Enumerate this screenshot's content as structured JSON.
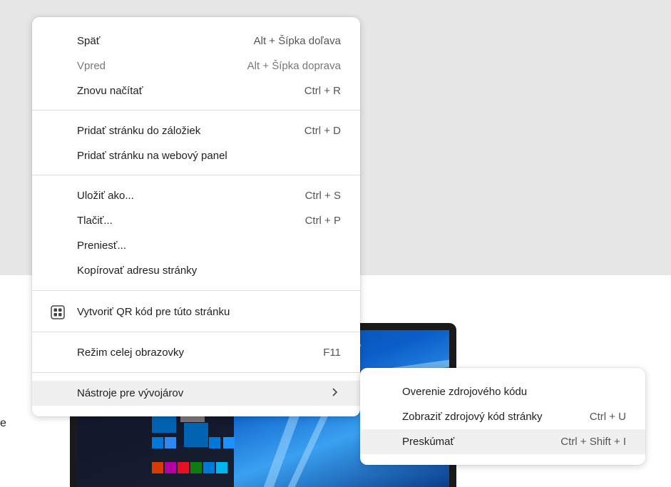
{
  "page": {
    "side_text": "e"
  },
  "context_menu": {
    "items": [
      {
        "label": "Späť",
        "shortcut": "Alt + Šípka doľava"
      },
      {
        "label": "Vpred",
        "shortcut": "Alt + Šípka doprava"
      },
      {
        "label": "Znovu načítať",
        "shortcut": "Ctrl + R"
      },
      {
        "label": "Pridať stránku do záložiek",
        "shortcut": "Ctrl + D"
      },
      {
        "label": "Pridať stránku na webový panel",
        "shortcut": ""
      },
      {
        "label": "Uložiť ako...",
        "shortcut": "Ctrl + S"
      },
      {
        "label": "Tlačiť...",
        "shortcut": "Ctrl + P"
      },
      {
        "label": "Preniesť...",
        "shortcut": ""
      },
      {
        "label": "Kopírovať adresu stránky",
        "shortcut": ""
      },
      {
        "label": "Vytvoriť QR kód pre túto stránku",
        "shortcut": "",
        "icon": "qr-code-icon"
      },
      {
        "label": "Režim celej obrazovky",
        "shortcut": "F11"
      },
      {
        "label": "Nástroje pre vývojárov",
        "shortcut": "",
        "icon": "chevron-right-icon"
      }
    ]
  },
  "dev_tools_submenu": {
    "items": [
      {
        "label": "Overenie zdrojového kódu",
        "shortcut": ""
      },
      {
        "label": "Zobraziť zdrojový kód stránky",
        "shortcut": "Ctrl + U"
      },
      {
        "label": "Preskúmať",
        "shortcut": "Ctrl + Shift + I"
      }
    ]
  },
  "colors": {
    "menu_bg": "#ffffff",
    "hover_bg": "#f0f0f0",
    "page_top_bg": "#e6e6e6"
  }
}
